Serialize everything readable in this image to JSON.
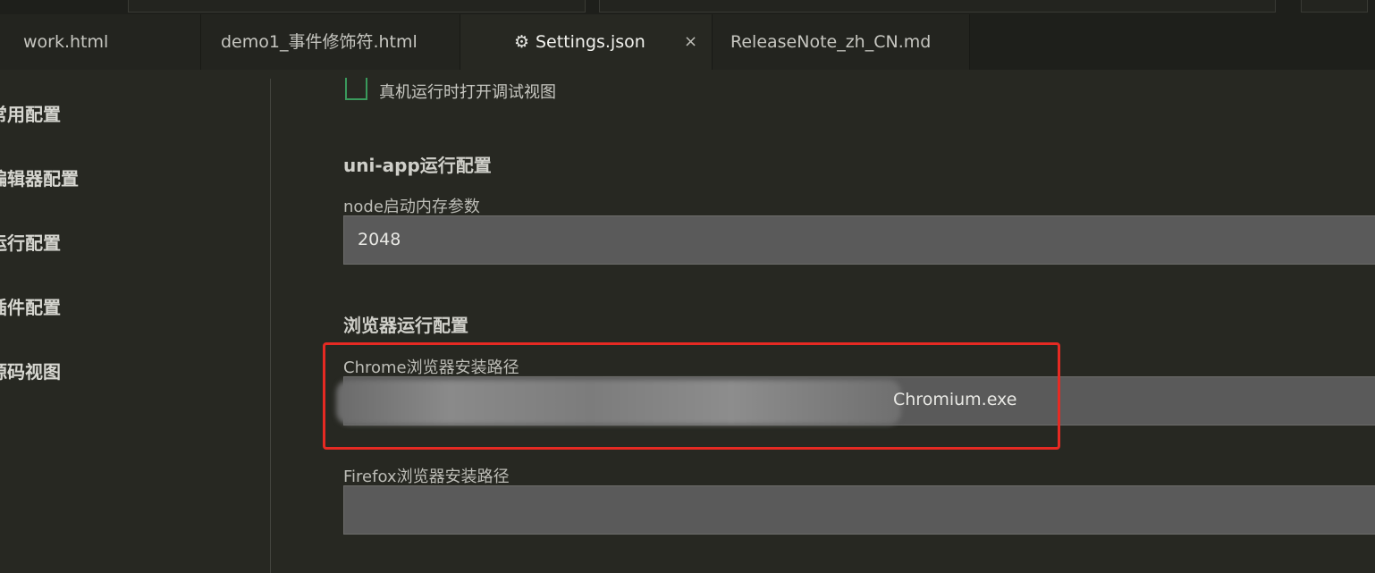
{
  "tabs": [
    {
      "label": "work.html",
      "active": false
    },
    {
      "label": "demo1_事件修饰符.html",
      "active": false
    },
    {
      "label": "Settings.json",
      "active": true,
      "icon": "gear-icon",
      "close": "×"
    },
    {
      "label": "ReleaseNote_zh_CN.md",
      "active": false
    }
  ],
  "sidebar": {
    "items": [
      {
        "label": "常用配置"
      },
      {
        "label": "编辑器配置"
      },
      {
        "label": "运行配置"
      },
      {
        "label": "插件配置"
      },
      {
        "label": "源码视图"
      }
    ]
  },
  "main": {
    "checkbox_label": "真机运行时打开调试视图",
    "checkbox_checked": false,
    "uniapp_section": "uni-app运行配置",
    "node_label": "node启动内存参数",
    "node_value": "2048",
    "browser_section": "浏览器运行配置",
    "chrome_label": "Chrome浏览器安装路径",
    "chrome_value_visible_suffix": "Chromium.exe",
    "firefox_label": "Firefox浏览器安装路径",
    "firefox_value": ""
  },
  "colors": {
    "background": "#272822",
    "tab_bar": "#1e1f1b",
    "input_bg": "#5a5a5a",
    "checkbox_border": "#3a9a5c",
    "highlight_border": "#e62a23"
  }
}
